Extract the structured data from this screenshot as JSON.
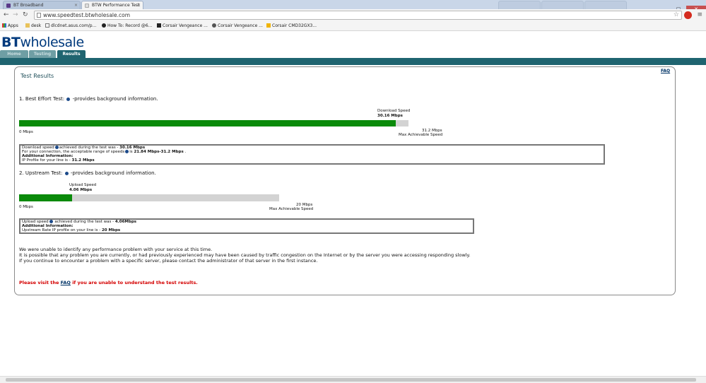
{
  "browser": {
    "tabs": [
      {
        "label": "BT Broadband"
      },
      {
        "label": "BTW Performance Test"
      },
      {
        "label": ""
      },
      {
        "label": ""
      },
      {
        "label": ""
      }
    ],
    "url": "www.speedtest.btwholesale.com",
    "bookmarks": [
      {
        "label": "Apps"
      },
      {
        "label": "desk"
      },
      {
        "label": "dlcdnet.asus.com/p..."
      },
      {
        "label": "How To: Record @6..."
      },
      {
        "label": "Corsair Vengeance ..."
      },
      {
        "label": "Corsair Vengeance ..."
      },
      {
        "label": "Corsair CMD32GX3..."
      }
    ]
  },
  "site": {
    "logo_bold": "BT",
    "logo_rest": "wholesale",
    "nav": [
      {
        "label": "Home"
      },
      {
        "label": "Testing"
      },
      {
        "label": "Results"
      }
    ]
  },
  "page": {
    "title": "Test Results",
    "faq": "FAQ",
    "download": {
      "heading_prefix": "1. Best Effort Test:",
      "heading_suffix": "-provides background information.",
      "speed_label": "Download Speed",
      "speed_value": "30.16 Mbps",
      "min_label": "0 Mbps",
      "max_value": "31.2 Mbps",
      "max_label": "Max Achievable Speed",
      "fill_fraction": 0.9667,
      "box": {
        "line1_prefix": "Download speed",
        "line1_mid": "achieved during the test was - ",
        "line1_value": "30.16 Mbps",
        "line2_prefix": "For your connection, the acceptable range of speeds",
        "line2_mid": "is ",
        "line2_value": "21.84 Mbps-31.2 Mbps",
        "line2_end": " .",
        "line3": "Additional Information:",
        "line4_prefix": "IP Profile for your line is - ",
        "line4_value": "31.2 Mbps"
      }
    },
    "upload": {
      "heading_prefix": "2. Upstream Test:",
      "heading_suffix": "-provides background information.",
      "speed_label": "Upload Speed",
      "speed_value": "4.06 Mbps",
      "min_label": "0 Mbps",
      "max_value": "20 Mbps",
      "max_label": "Max Achievable Speed",
      "fill_fraction": 0.203,
      "box": {
        "line1_prefix": "Upload speed",
        "line1_mid": " achieved during the test was - ",
        "line1_value": "4.06Mbps",
        "line2": "Additional Information:",
        "line3_prefix": "Upstream Rate IP profile on your line is - ",
        "line3_value": "20 Mbps"
      }
    },
    "messages": [
      "We were unable to identify any performance problem with your service at this time.",
      "It is possible that any problem you are currently, or had previously experienced may have been caused by traffic congestion on the Internet or by the server you were accessing responding slowly.",
      "If you continue to encounter a problem with a specific server, please contact the administrator of that server in the first instance."
    ],
    "warning_prefix": "Please visit the ",
    "warning_link": "FAQ",
    "warning_suffix": " if you are unable to understand the test results."
  },
  "colors": {
    "accent": "#1f6470",
    "bar_fill": "#0a8a0a",
    "bar_track": "#d3d3d3",
    "warning": "#d40000"
  }
}
